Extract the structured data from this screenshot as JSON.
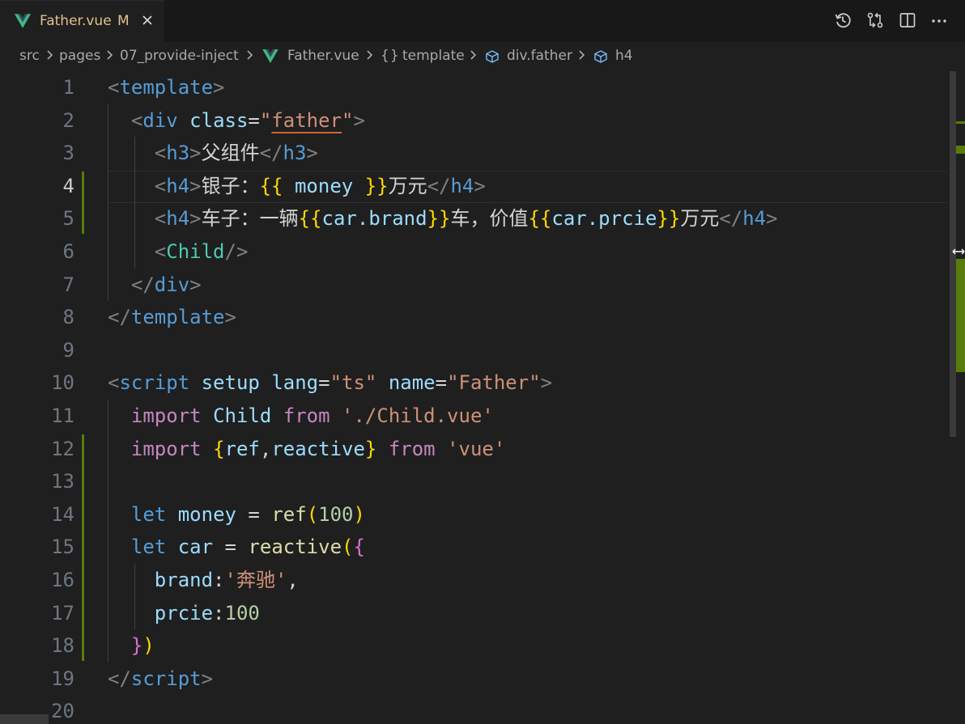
{
  "tab": {
    "file_name": "Father.vue",
    "status": "M"
  },
  "breadcrumb": {
    "src": "src",
    "pages": "pages",
    "folder": "07_provide-inject",
    "file": "Father.vue",
    "template_label": "template",
    "div_label": "div.father",
    "h4_label": "h4"
  },
  "editor": {
    "active_line": 4,
    "lines": [
      {
        "number": "1",
        "tokens": [
          [
            "<",
            "t-p"
          ],
          [
            "template",
            "t-tag"
          ],
          [
            ">",
            "t-p"
          ]
        ]
      },
      {
        "number": "2",
        "tokens": [
          [
            "  <",
            "t-p"
          ],
          [
            "div",
            "t-tag"
          ],
          [
            " ",
            "t-txt"
          ],
          [
            "class",
            "t-attr"
          ],
          [
            "=",
            "t-txt"
          ],
          [
            "\"",
            "t-str"
          ],
          [
            "father",
            "t-str warn"
          ],
          [
            "\"",
            "t-str"
          ],
          [
            ">",
            "t-p"
          ]
        ]
      },
      {
        "number": "3",
        "tokens": [
          [
            "    <",
            "t-p"
          ],
          [
            "h3",
            "t-tag"
          ],
          [
            ">",
            "t-p"
          ],
          [
            "父组件",
            "t-txt"
          ],
          [
            "</",
            "t-p"
          ],
          [
            "h3",
            "t-tag"
          ],
          [
            ">",
            "t-p"
          ]
        ]
      },
      {
        "number": "4",
        "tokens": [
          [
            "    <",
            "t-p"
          ],
          [
            "h4",
            "t-tag"
          ],
          [
            ">",
            "t-p"
          ],
          [
            "银子：",
            "t-txt"
          ],
          [
            "{{",
            "t-b1"
          ],
          [
            " money ",
            "t-var"
          ],
          [
            "}}",
            "t-b1"
          ],
          [
            "万元",
            "t-txt"
          ],
          [
            "</",
            "t-p"
          ],
          [
            "h4",
            "t-tag"
          ],
          [
            ">",
            "t-p"
          ]
        ]
      },
      {
        "number": "5",
        "tokens": [
          [
            "    <",
            "t-p"
          ],
          [
            "h4",
            "t-tag"
          ],
          [
            ">",
            "t-p"
          ],
          [
            "车子：一辆",
            "t-txt"
          ],
          [
            "{{",
            "t-b1"
          ],
          [
            "car.brand",
            "t-var"
          ],
          [
            "}}",
            "t-b1"
          ],
          [
            "车，价值",
            "t-txt"
          ],
          [
            "{{",
            "t-b1"
          ],
          [
            "car.prcie",
            "t-var"
          ],
          [
            "}}",
            "t-b1"
          ],
          [
            "万元",
            "t-txt"
          ],
          [
            "</",
            "t-p"
          ],
          [
            "h4",
            "t-tag"
          ],
          [
            ">",
            "t-p"
          ]
        ]
      },
      {
        "number": "6",
        "tokens": [
          [
            "    <",
            "t-p"
          ],
          [
            "Child",
            "t-comp"
          ],
          [
            "/>",
            "t-p"
          ]
        ]
      },
      {
        "number": "7",
        "tokens": [
          [
            "  </",
            "t-p"
          ],
          [
            "div",
            "t-tag"
          ],
          [
            ">",
            "t-p"
          ]
        ]
      },
      {
        "number": "8",
        "tokens": [
          [
            "</",
            "t-p"
          ],
          [
            "template",
            "t-tag"
          ],
          [
            ">",
            "t-p"
          ]
        ]
      },
      {
        "number": "9",
        "tokens": []
      },
      {
        "number": "10",
        "tokens": [
          [
            "<",
            "t-p"
          ],
          [
            "script",
            "t-tag"
          ],
          [
            " ",
            "t-txt"
          ],
          [
            "setup",
            "t-attr"
          ],
          [
            " ",
            "t-txt"
          ],
          [
            "lang",
            "t-attr"
          ],
          [
            "=",
            "t-txt"
          ],
          [
            "\"ts\"",
            "t-str"
          ],
          [
            " ",
            "t-txt"
          ],
          [
            "name",
            "t-attr"
          ],
          [
            "=",
            "t-txt"
          ],
          [
            "\"Father\"",
            "t-str"
          ],
          [
            ">",
            "t-p"
          ]
        ]
      },
      {
        "number": "11",
        "tokens": [
          [
            "  ",
            "t-txt"
          ],
          [
            "import",
            "t-imp"
          ],
          [
            " ",
            "t-txt"
          ],
          [
            "Child",
            "t-var"
          ],
          [
            " ",
            "t-txt"
          ],
          [
            "from",
            "t-imp"
          ],
          [
            " ",
            "t-txt"
          ],
          [
            "'./Child.vue'",
            "t-str"
          ]
        ]
      },
      {
        "number": "12",
        "tokens": [
          [
            "  ",
            "t-txt"
          ],
          [
            "import",
            "t-imp"
          ],
          [
            " ",
            "t-txt"
          ],
          [
            "{",
            "t-b1"
          ],
          [
            "ref",
            "t-var"
          ],
          [
            ",",
            "t-op"
          ],
          [
            "reactive",
            "t-var"
          ],
          [
            "}",
            "t-b1"
          ],
          [
            " ",
            "t-txt"
          ],
          [
            "from",
            "t-imp"
          ],
          [
            " ",
            "t-txt"
          ],
          [
            "'vue'",
            "t-str"
          ]
        ]
      },
      {
        "number": "13",
        "tokens": []
      },
      {
        "number": "14",
        "tokens": [
          [
            "  ",
            "t-txt"
          ],
          [
            "let",
            "t-kw"
          ],
          [
            " ",
            "t-txt"
          ],
          [
            "money",
            "t-var"
          ],
          [
            " = ",
            "t-op"
          ],
          [
            "ref",
            "t-fn"
          ],
          [
            "(",
            "t-b1"
          ],
          [
            "100",
            "t-num"
          ],
          [
            ")",
            "t-b1"
          ]
        ]
      },
      {
        "number": "15",
        "tokens": [
          [
            "  ",
            "t-txt"
          ],
          [
            "let",
            "t-kw"
          ],
          [
            " ",
            "t-txt"
          ],
          [
            "car",
            "t-var"
          ],
          [
            " = ",
            "t-op"
          ],
          [
            "reactive",
            "t-fn"
          ],
          [
            "(",
            "t-b1"
          ],
          [
            "{",
            "t-b2"
          ]
        ]
      },
      {
        "number": "16",
        "tokens": [
          [
            "    ",
            "t-txt"
          ],
          [
            "brand",
            "t-var"
          ],
          [
            ":",
            "t-op"
          ],
          [
            "'奔驰'",
            "t-str"
          ],
          [
            ",",
            "t-op"
          ]
        ]
      },
      {
        "number": "17",
        "tokens": [
          [
            "    ",
            "t-txt"
          ],
          [
            "prcie",
            "t-var"
          ],
          [
            ":",
            "t-op"
          ],
          [
            "100",
            "t-num"
          ]
        ]
      },
      {
        "number": "18",
        "tokens": [
          [
            "  ",
            "t-txt"
          ],
          [
            "}",
            "t-b2"
          ],
          [
            ")",
            "t-b1"
          ]
        ]
      },
      {
        "number": "19",
        "tokens": [
          [
            "</",
            "t-p"
          ],
          [
            "script",
            "t-tag"
          ],
          [
            ">",
            "t-p"
          ]
        ]
      },
      {
        "number": "20",
        "tokens": []
      }
    ]
  },
  "icons": {
    "tab_file": "vue-icon",
    "tab_close": "close-icon",
    "timeline": "history-icon",
    "compare": "compare-changes-icon",
    "split": "split-editor-icon",
    "more": "more-actions-icon",
    "symbol": "symbol-box-icon"
  }
}
